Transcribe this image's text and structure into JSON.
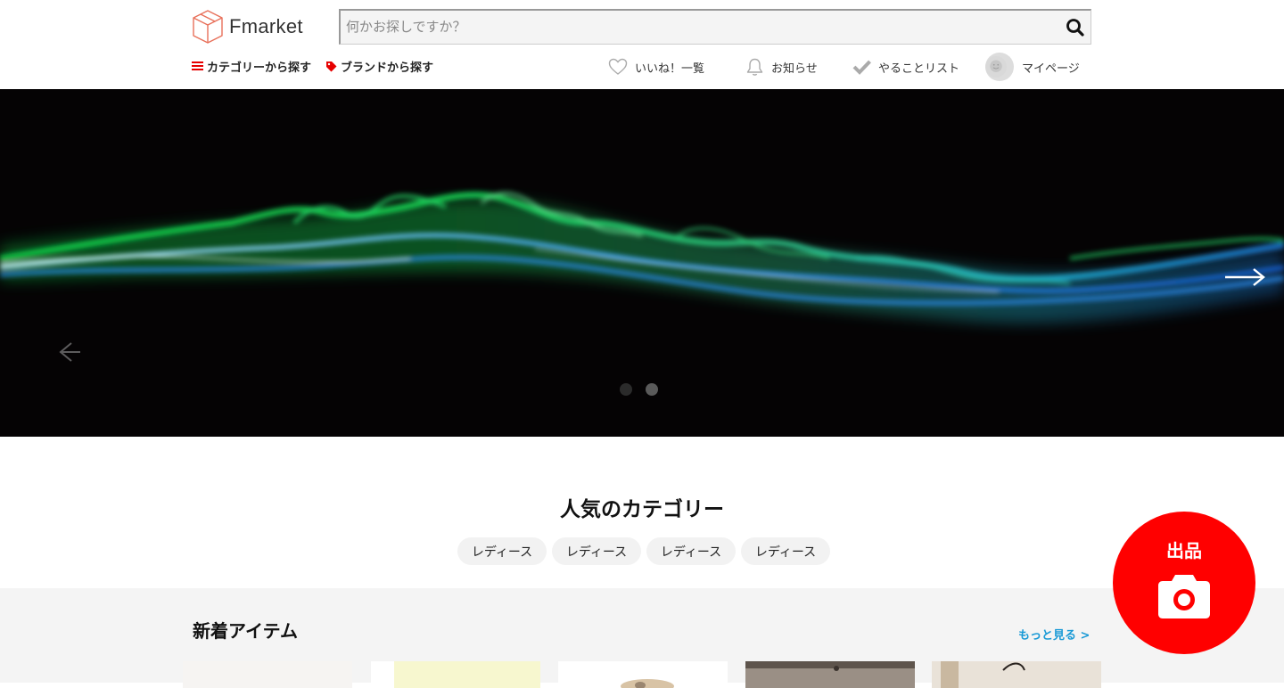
{
  "header": {
    "logo_text": "Fmarket",
    "search": {
      "placeholder": "何かお探しですか？",
      "value": ""
    },
    "nav_left": [
      {
        "label": "カテゴリーから探す",
        "icon": "menu-icon"
      },
      {
        "label": "ブランドから探す",
        "icon": "tag-icon"
      }
    ],
    "nav_right": [
      {
        "label": "いいね！一覧",
        "icon": "heart-icon"
      },
      {
        "label": "お知らせ",
        "icon": "bell-icon"
      },
      {
        "label": "やることリスト",
        "icon": "check-icon"
      },
      {
        "label": "マイページ",
        "icon": "avatar"
      }
    ]
  },
  "hero": {
    "slide_count": 2,
    "active_slide": 2
  },
  "categories": {
    "title": "人気のカテゴリー",
    "chips": [
      "レディース",
      "レディース",
      "レディース",
      "レディース"
    ]
  },
  "new_items": {
    "title": "新着アイテム",
    "more_label": "もっと見る >",
    "thumb_count": 5
  },
  "sell_button": {
    "label": "出品",
    "icon": "camera-icon"
  },
  "colors": {
    "accent": "#ff0000",
    "link": "#1a9ad6",
    "logo_icon": "#e8705a",
    "hero_bg": "#050304"
  }
}
